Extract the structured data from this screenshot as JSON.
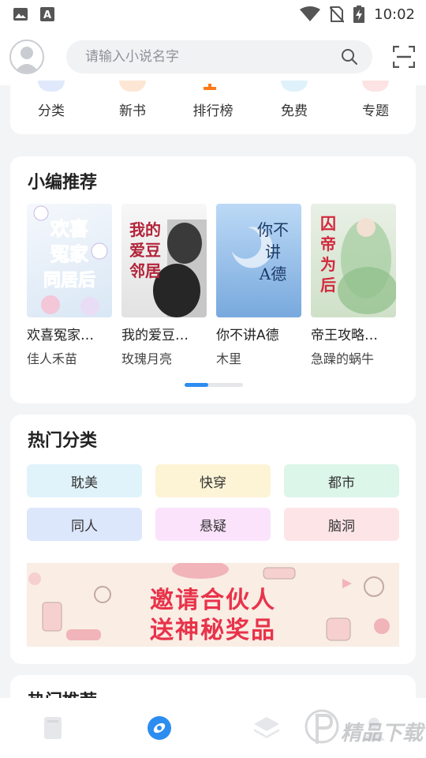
{
  "status_bar": {
    "time": "10:02",
    "left_icons": [
      "image-icon",
      "font-a-icon"
    ],
    "right_icons": [
      "wifi-icon",
      "no-sim-icon",
      "battery-charging-icon"
    ]
  },
  "header": {
    "search_placeholder": "请输入小说名字"
  },
  "quick_nav": [
    {
      "label": "分类",
      "color": "#dfe9fb"
    },
    {
      "label": "新书",
      "color": "#fde6d3"
    },
    {
      "label": "排行榜",
      "color": "#ff7a1a"
    },
    {
      "label": "免费",
      "color": "#dff2fb"
    },
    {
      "label": "专题",
      "color": "#fde3e3"
    }
  ],
  "editor_picks": {
    "title": "小编推荐",
    "books": [
      {
        "title": "欢喜冤家…",
        "author": "佳人禾苗",
        "cover_text": "欢喜冤家同居后"
      },
      {
        "title": "我的爱豆…",
        "author": "玫瑰月亮",
        "cover_text": "我的爱豆邻居"
      },
      {
        "title": "你不讲A德",
        "author": "木里",
        "cover_text": "你不讲A德"
      },
      {
        "title": "帝王攻略…",
        "author": "急躁的蜗牛",
        "cover_text": "囚帝为后"
      }
    ]
  },
  "hot_categories": {
    "title": "热门分类",
    "items": [
      {
        "label": "耽美",
        "color": "#e0f3fb"
      },
      {
        "label": "快穿",
        "color": "#fdf4d6"
      },
      {
        "label": "都市",
        "color": "#dcf6ea"
      },
      {
        "label": "同人",
        "color": "#dde7fb"
      },
      {
        "label": "悬疑",
        "color": "#fbe3fb"
      },
      {
        "label": "脑洞",
        "color": "#fde5e7"
      }
    ],
    "banner_line1": "邀请合伙人",
    "banner_line2": "送神秘奖品"
  },
  "hot_recommend": {
    "title": "热门推荐"
  },
  "tab_bar": [
    {
      "name": "bookshelf-icon",
      "active": false
    },
    {
      "name": "discover-icon",
      "active": true
    },
    {
      "name": "layers-icon",
      "active": false
    },
    {
      "name": "profile-icon",
      "active": false
    }
  ],
  "watermark": "精品下载",
  "colors": {
    "accent": "#2d8cf0",
    "banner_text": "#e8334a"
  }
}
